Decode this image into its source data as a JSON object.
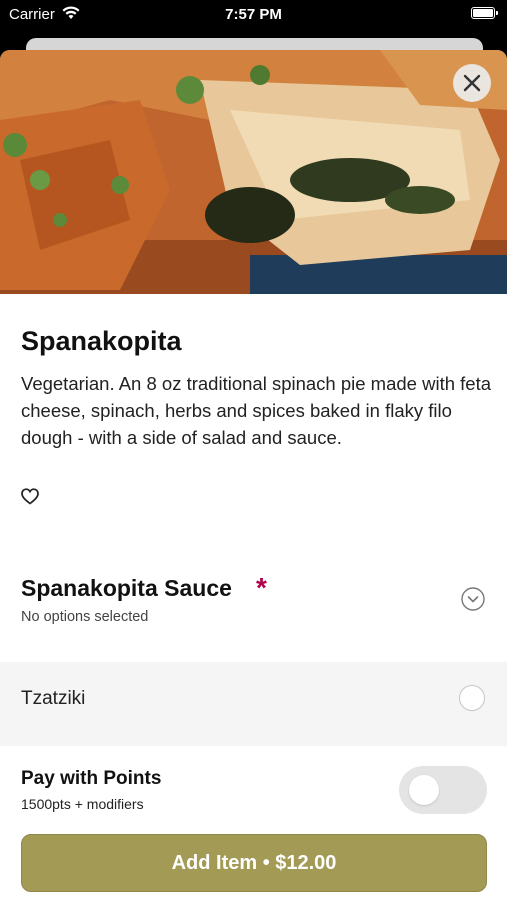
{
  "status_bar": {
    "carrier": "Carrier",
    "time": "7:57 PM"
  },
  "item": {
    "title": "Spanakopita",
    "description": "Vegetarian. An 8 oz traditional spinach pie made with feta cheese, spinach, herbs and spices baked in flaky filo dough - with a side of salad and sauce.",
    "hero_image": "spanakopita-photo"
  },
  "modifier_group": {
    "title": "Spanakopita Sauce",
    "required_mark": "*",
    "status": "No options selected",
    "options": [
      {
        "label": "Tzatziki",
        "selected": false
      }
    ]
  },
  "points": {
    "title": "Pay with Points",
    "subtitle": "1500pts + modifiers",
    "enabled": false
  },
  "cta": {
    "label": "Add Item • $12.00"
  },
  "colors": {
    "accent": "#a39a56",
    "required": "#b0004a",
    "option_bg": "#f5f5f5"
  },
  "icons": [
    "wifi-icon",
    "battery-icon",
    "close-icon",
    "heart-icon",
    "chevron-down-circle-icon"
  ]
}
